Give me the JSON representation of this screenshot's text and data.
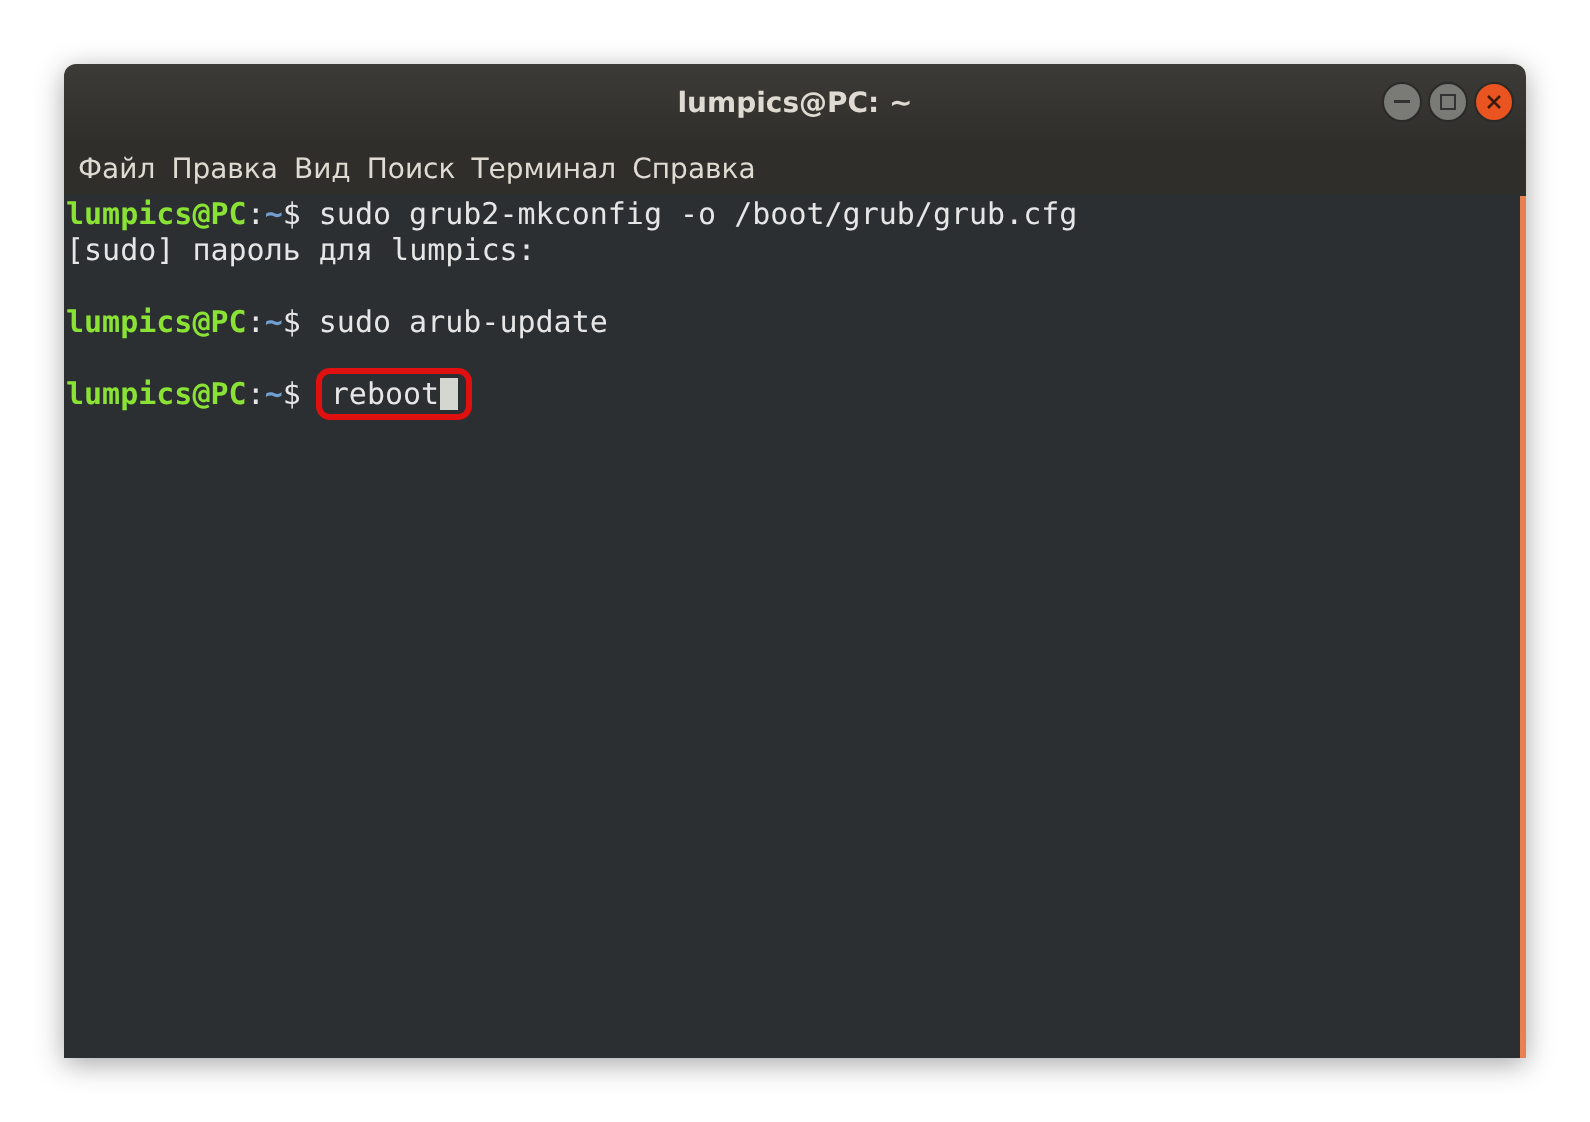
{
  "window": {
    "title": "lumpics@PC: ~"
  },
  "window_buttons": [
    {
      "kind": "minimize"
    },
    {
      "kind": "maximize"
    },
    {
      "kind": "close"
    }
  ],
  "menu": [
    "Файл",
    "Правка",
    "Вид",
    "Поиск",
    "Терминал",
    "Справка"
  ],
  "lines": [
    {
      "kind": "prompt",
      "host": "lumpics@PC",
      "sep": ":",
      "path": "~",
      "symbol": "$",
      "command": "sudo grub2-mkconfig -o /boot/grub/grub.cfg",
      "highlighted": false,
      "cursor": false
    },
    {
      "kind": "output",
      "text": "[sudo] пароль для lumpics:"
    },
    {
      "kind": "blank"
    },
    {
      "kind": "prompt",
      "host": "lumpics@PC",
      "sep": ":",
      "path": "~",
      "symbol": "$",
      "command": "sudo arub-update",
      "highlighted": false,
      "cursor": false
    },
    {
      "kind": "blank"
    },
    {
      "kind": "prompt",
      "host": "lumpics@PC",
      "sep": ":",
      "path": "~",
      "symbol": "$",
      "command": "reboot",
      "highlighted": true,
      "cursor": true
    }
  ]
}
